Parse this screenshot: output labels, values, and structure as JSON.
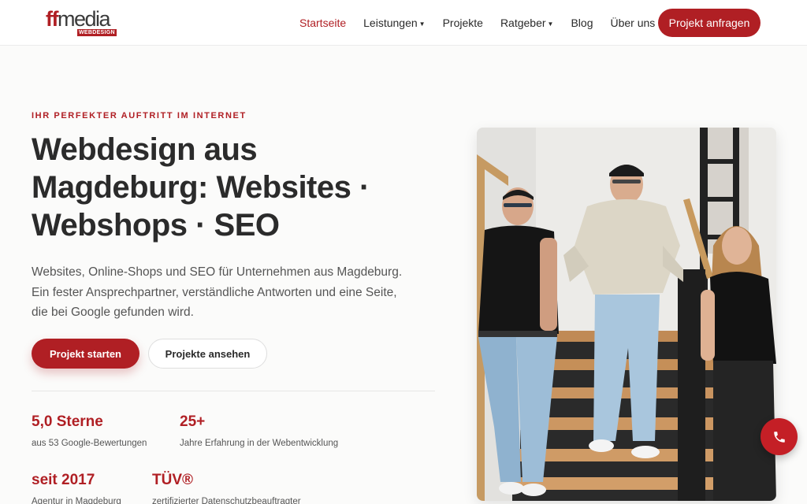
{
  "brand": {
    "logo_ff": "ff",
    "logo_media": "media",
    "logo_sub": "WEBDESIGN"
  },
  "nav": {
    "items": [
      {
        "label": "Startseite",
        "active": true,
        "dropdown": false
      },
      {
        "label": "Leistungen",
        "active": false,
        "dropdown": true
      },
      {
        "label": "Projekte",
        "active": false,
        "dropdown": false
      },
      {
        "label": "Ratgeber",
        "active": false,
        "dropdown": true
      },
      {
        "label": "Blog",
        "active": false,
        "dropdown": false
      },
      {
        "label": "Über uns",
        "active": false,
        "dropdown": false
      }
    ],
    "cta_label": "Projekt anfragen"
  },
  "hero": {
    "eyebrow": "IHR PERFEKTER AUFTRITT IM INTERNET",
    "headline_line1": "Webdesign aus",
    "headline_line2": "Magdeburg: Websites ·",
    "headline_line3": "Webshops · SEO",
    "lead_line1": "Websites, Online-Shops und SEO für Unternehmen aus Magdeburg.",
    "lead_line2": "Ein fester Ansprechpartner, verständliche Antworten und eine Seite,",
    "lead_line3": "die bei Google gefunden wird.",
    "primary_button": "Projekt starten",
    "secondary_button": "Projekte ansehen"
  },
  "stats": [
    {
      "value": "5,0 Sterne",
      "label": "aus 53 Google-Bewertungen"
    },
    {
      "value": "25+",
      "label": "Jahre Erfahrung in der Webentwicklung"
    },
    {
      "value": "seit 2017",
      "label": "Agentur in Magdeburg"
    },
    {
      "value": "TÜV®",
      "label": "zertifizierter Datenschutzbeauftragter"
    }
  ],
  "colors": {
    "brand_red": "#b01f24",
    "text_dark": "#2b2b2b",
    "text_muted": "#555555"
  },
  "icons": {
    "dropdown": "caret-down-icon",
    "call": "phone-icon"
  }
}
